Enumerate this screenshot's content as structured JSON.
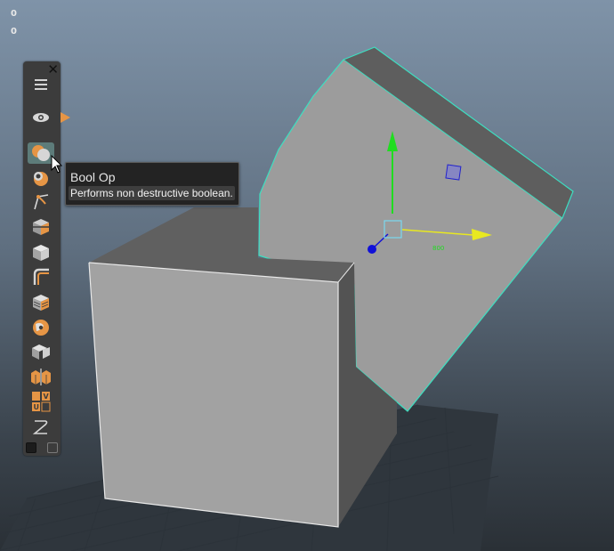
{
  "hud": {
    "line1": "0",
    "line2": "0"
  },
  "toolbar": {
    "close_glyph": "✕",
    "tools": [
      {
        "icon": "menu-icon"
      },
      {
        "icon": "eye-icon"
      },
      {
        "icon": "bool-op-icon",
        "active": true
      },
      {
        "icon": "bool-sphere-icon"
      },
      {
        "icon": "bevel-curve-icon"
      },
      {
        "icon": "cube-slice-icon"
      },
      {
        "icon": "cube-icon"
      },
      {
        "icon": "corner-icon"
      },
      {
        "icon": "cube-hatch-icon"
      },
      {
        "icon": "sphere-orange-icon"
      },
      {
        "icon": "cube-split-icon"
      },
      {
        "icon": "mirror-cubes-icon"
      },
      {
        "icon": "uv-icon"
      },
      {
        "icon": "curve-z-icon"
      }
    ],
    "uv_letters": [
      "U",
      "V"
    ],
    "swatches": {
      "left": "#1c1c1c",
      "right": "#3c3c3c"
    }
  },
  "tooltip": {
    "title": "Bool Op",
    "description": "Performs non destructive boolean."
  },
  "colors": {
    "accent_orange": "#e69545",
    "selection_outline": "#3ddfc0",
    "gizmo_y": "#20dd20",
    "gizmo_x": "#e8e820",
    "gizmo_z": "#1010d8",
    "gizmo_center": "#7ad8f0",
    "tool_highlight": "#5d7c7a"
  },
  "scene": {
    "gizmo_label": "800"
  }
}
